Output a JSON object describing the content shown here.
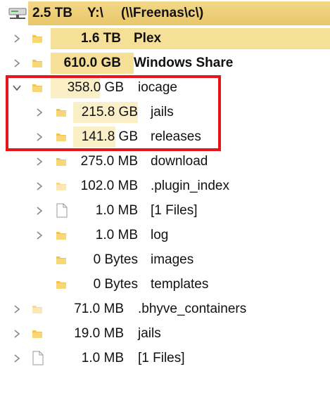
{
  "root": {
    "size": "2.5 TB",
    "drive": "Y:\\",
    "path": "(\\\\Freenas\\c\\)",
    "icon": "network-drive-icon"
  },
  "rows": [
    {
      "size": "1.6 TB",
      "name": "Plex",
      "icon": "folder-icon",
      "expander": "chevron-right-icon"
    },
    {
      "size": "610.0 GB",
      "name": "Windows Share",
      "icon": "folder-icon",
      "expander": "chevron-right-icon"
    },
    {
      "size": "358.0 GB",
      "name": "iocage",
      "icon": "folder-icon",
      "expander": "chevron-down-icon"
    },
    {
      "size": "215.8 GB",
      "name": "jails",
      "icon": "folder-icon",
      "expander": "chevron-right-icon"
    },
    {
      "size": "141.8 GB",
      "name": "releases",
      "icon": "folder-icon",
      "expander": "chevron-right-icon"
    },
    {
      "size": "275.0 MB",
      "name": "download",
      "icon": "folder-icon",
      "expander": "chevron-right-icon"
    },
    {
      "size": "102.0 MB",
      "name": ".plugin_index",
      "icon": "folder-icon",
      "expander": "chevron-right-icon"
    },
    {
      "size": "1.0 MB",
      "name": "[1 Files]",
      "icon": "file-icon",
      "expander": "chevron-right-icon"
    },
    {
      "size": "1.0 MB",
      "name": "log",
      "icon": "folder-icon",
      "expander": "chevron-right-icon"
    },
    {
      "size": "0 Bytes",
      "name": "images",
      "icon": "folder-icon",
      "expander": ""
    },
    {
      "size": "0 Bytes",
      "name": "templates",
      "icon": "folder-icon",
      "expander": ""
    },
    {
      "size": "71.0 MB",
      "name": ".bhyve_containers",
      "icon": "folder-icon",
      "expander": "chevron-right-icon"
    },
    {
      "size": "19.0 MB",
      "name": "jails",
      "icon": "folder-icon",
      "expander": "chevron-right-icon"
    },
    {
      "size": "1.0 MB",
      "name": "[1 Files]",
      "icon": "file-icon",
      "expander": "chevron-right-icon"
    }
  ],
  "colors": {
    "bar_dark": "#f2d47c",
    "bar_mid": "#f6df96",
    "bar_light": "#fbefc8",
    "annotation": "#e8141c"
  }
}
